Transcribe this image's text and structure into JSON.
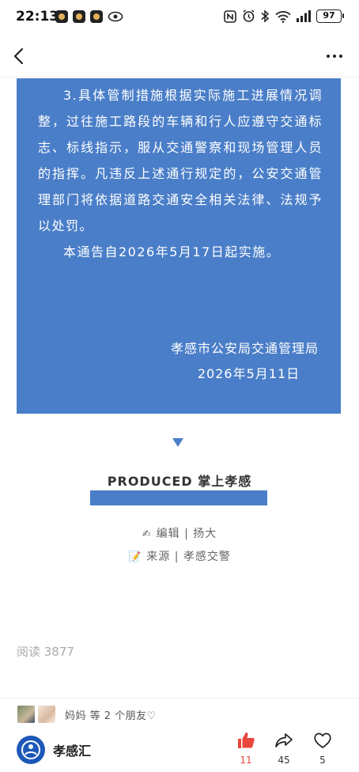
{
  "status_bar": {
    "time": "22:13",
    "battery": "97"
  },
  "nav": {
    "back_icon": "chevron-left-icon",
    "more_icon": "more-horizontal-icon"
  },
  "notice": {
    "para_3": "3.具体管制措施根据实际施工进展情况调整，过往施工路段的车辆和行人应遵守交通标志、标线指示，服从交通警察和现场管理人员的指挥。凡违反上述通行规定的，公安交通管理部门将依据道路交通安全相关法律、法规予以处罚。",
    "effective": "本通告自2026年5月17日起实施。",
    "issuer": "孝感市公安局交通管理局",
    "date": "2026年5月11日"
  },
  "produced": {
    "title": "PRODUCED 掌上孝感",
    "editor_line": "编辑 | 扬大",
    "source_line": "来源 | 孝感交警"
  },
  "stats": {
    "read_count": "阅读 3877"
  },
  "friends": {
    "text": "妈妈 等 2 个朋友♡"
  },
  "bottom": {
    "account_name": "孝感汇",
    "like_count": "11",
    "share_count": "45",
    "fav_count": "5"
  },
  "colors": {
    "accent_blue": "#4a7ec8",
    "like_red": "#e8453c"
  }
}
